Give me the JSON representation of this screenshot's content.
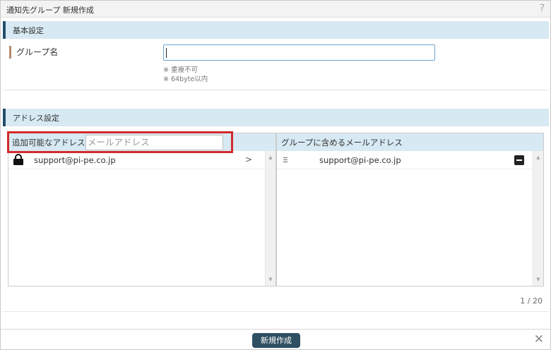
{
  "window": {
    "title": "通知先グループ 新規作成",
    "help_glyph": "?"
  },
  "basic_section": {
    "heading": "基本設定",
    "group_name_label": "グループ名",
    "group_name_value": "",
    "notes": [
      "※ 重複不可",
      "※ 64byte以内"
    ]
  },
  "address_section": {
    "heading": "アドレス設定",
    "available": {
      "label": "追加可能なアドレス",
      "search_placeholder": "メールアドレス",
      "items": [
        {
          "email": "support@pi-pe.co.jp",
          "lock_icon": "lock-icon",
          "action_glyph": ">"
        }
      ]
    },
    "group": {
      "label": "グループに含めるメールアドレス",
      "items": [
        {
          "email": "support@pi-pe.co.jp",
          "handle_icon": "drag-handle-icon",
          "remove_icon": "minus-icon"
        }
      ]
    },
    "pagination": "1 / 20"
  },
  "footer": {
    "create_label": "新規作成",
    "close_glyph": "✕"
  },
  "colors": {
    "section_bg": "#d7e9f3",
    "section_accent": "#23506b",
    "label_accent": "#b58a6c",
    "highlight_border": "#d32b2b",
    "primary_button": "#2f4f63"
  }
}
